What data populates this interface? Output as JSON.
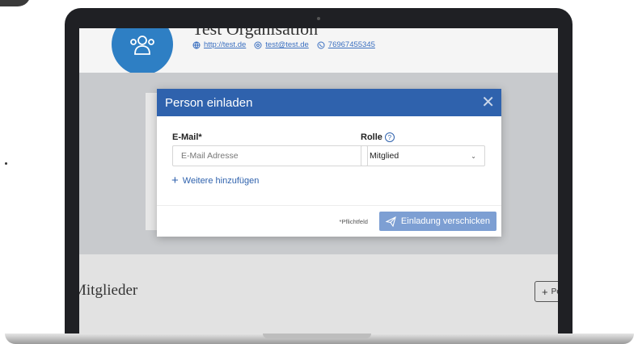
{
  "background_page": {
    "org_name": "Test Organisation",
    "contacts": {
      "website": "http://test.de",
      "email": "test@test.de",
      "phone": "76967455345"
    },
    "members_title": "Mitglieder",
    "add_person_label": "Person"
  },
  "modal": {
    "title": "Person einladen",
    "email_label": "E-Mail*",
    "email_placeholder": "E-Mail Adresse",
    "email_value": "",
    "role_label": "Rolle",
    "role_value": "Mitglied",
    "add_more_label": "Weitere hinzufügen",
    "required_note": "*Pflichtfeld",
    "send_label": "Einladung verschicken"
  },
  "colors": {
    "header_blue": "#2f62ad",
    "button_blue_disabled": "#7d9fd3",
    "avatar_blue": "#2e7fc4",
    "link_blue": "#3a6fc0"
  },
  "icons": {
    "avatar": "group-icon",
    "website": "globe-icon",
    "email": "at-icon",
    "phone": "phone-icon",
    "close": "close-icon",
    "help": "help-circle-icon",
    "dropdown": "chevron-down-icon",
    "add": "plus-icon",
    "send": "paper-plane-icon"
  }
}
